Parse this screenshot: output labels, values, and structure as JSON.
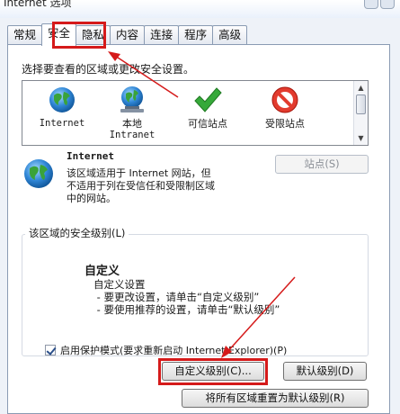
{
  "window": {
    "title": "Internet 选项"
  },
  "tabs": [
    {
      "label": "常规"
    },
    {
      "label": "安全"
    },
    {
      "label": "隐私"
    },
    {
      "label": "内容"
    },
    {
      "label": "连接"
    },
    {
      "label": "程序"
    },
    {
      "label": "高级"
    }
  ],
  "active_tab": "安全",
  "zone_prompt": "选择要查看的区域或更改安全设置。",
  "zones": [
    {
      "label": "Internet",
      "label2": "",
      "icon": "globe-icon"
    },
    {
      "label": "本地",
      "label2": "Intranet",
      "icon": "intranet-globe-icon"
    },
    {
      "label": "可信站点",
      "label2": "",
      "icon": "checkmark-icon"
    },
    {
      "label": "受限站点",
      "label2": "",
      "icon": "restricted-icon"
    }
  ],
  "selected_zone": {
    "title": "Internet",
    "desc_lines": [
      "该区域适用于 Internet 网站，但",
      "不适用于列在受信任和受限制区域",
      "中的网站。"
    ],
    "sites_button": "站点(S)"
  },
  "security_level": {
    "legend": "该区域的安全级别(L)",
    "title": "自定义",
    "desc": "自定义设置\n - 要更改设置，请单击“自定义级别”\n - 要使用推荐的设置，请单击“默认级别”"
  },
  "protected_mode": {
    "label": "启用保护模式(要求重新启动 Internet Explorer)(P)",
    "checked": true
  },
  "buttons": {
    "custom_level": "自定义级别(C)...",
    "default_level": "默认级别(D)",
    "reset_all": "将所有区域重置为默认级别(R)"
  },
  "annotation_color": "#d51a1a"
}
